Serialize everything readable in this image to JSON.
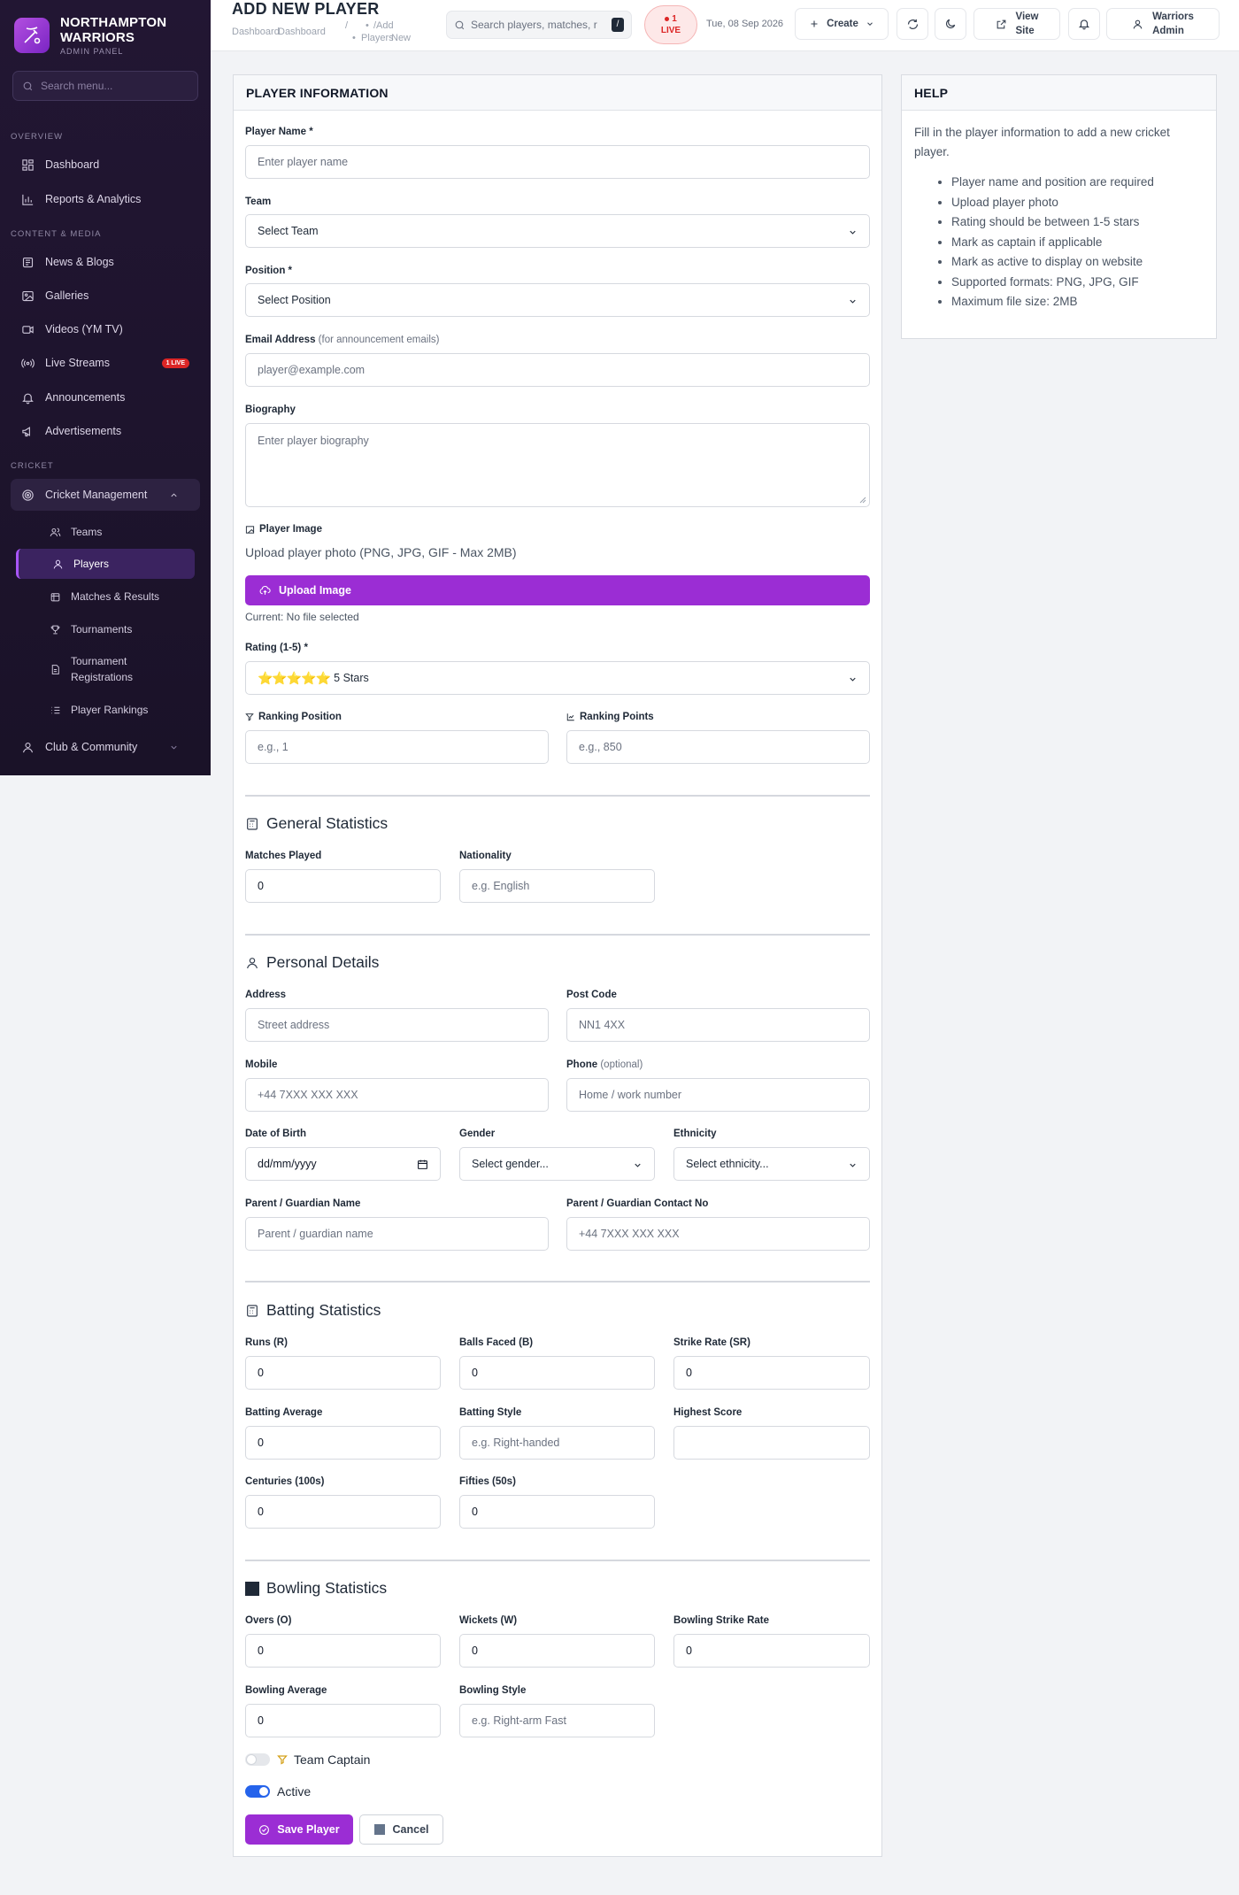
{
  "brand": {
    "name_line1": "NORTHAMPTON",
    "name_line2": "WARRIORS",
    "subtitle": "ADMIN PANEL"
  },
  "sidebar": {
    "search_placeholder": "Search menu...",
    "sections": {
      "overview": "OVERVIEW",
      "content": "CONTENT & MEDIA",
      "cricket": "CRICKET"
    },
    "items": {
      "dashboard": "Dashboard",
      "reports": "Reports & Analytics",
      "news": "News & Blogs",
      "galleries": "Galleries",
      "videos": "Videos (YM TV)",
      "live_streams": "Live Streams",
      "live_badge": "1 LIVE",
      "announcements": "Announcements",
      "advertisements": "Advertisements",
      "cricket_mgmt": "Cricket Management",
      "club": "Club & Community"
    },
    "sub_items": {
      "teams": "Teams",
      "players": "Players",
      "matches": "Matches & Results",
      "tournaments": "Tournaments",
      "registrations_1": "Tournament",
      "registrations_2": "Registrations",
      "rankings": "Player Rankings"
    }
  },
  "topbar": {
    "title": "ADD NEW PLAYER",
    "breadcrumbs": [
      "Dashboard",
      "Dashboard",
      "/",
      "/Add",
      "Players",
      "New"
    ],
    "search_placeholder": "Search players, matches, r",
    "search_kbd": "/",
    "live_count": "1",
    "live_label": "LIVE",
    "date": "Tue, 08 Sep 2026",
    "create_label": "Create",
    "view_site_1": "View",
    "view_site_2": "Site",
    "user_1": "Warriors",
    "user_2": "Admin"
  },
  "form": {
    "header": "PLAYER INFORMATION",
    "player_name": {
      "label": "Player Name *",
      "placeholder": "Enter player name"
    },
    "team": {
      "label": "Team",
      "value": "Select Team"
    },
    "position": {
      "label": "Position *",
      "value": "Select Position"
    },
    "email": {
      "label": "Email Address",
      "hint": "(for announcement emails)",
      "placeholder": "player@example.com"
    },
    "biography": {
      "label": "Biography",
      "placeholder": "Enter player biography"
    },
    "image": {
      "label": "Player Image",
      "help": "Upload player photo (PNG, JPG, GIF - Max 2MB)",
      "button": "Upload Image",
      "current": "Current: No file selected"
    },
    "rating": {
      "label": "Rating (1-5) *",
      "stars": "⭐⭐⭐⭐⭐",
      "value": "5 Stars",
      "level": 5
    },
    "ranking_position": {
      "label": "Ranking Position",
      "placeholder": "e.g., 1"
    },
    "ranking_points": {
      "label": "Ranking Points",
      "placeholder": "e.g., 850"
    },
    "general": {
      "title": "General Statistics",
      "matches": {
        "label": "Matches Played",
        "value": "0"
      },
      "nationality": {
        "label": "Nationality",
        "placeholder": "e.g. English"
      }
    },
    "personal": {
      "title": "Personal Details",
      "address": {
        "label": "Address",
        "placeholder": "Street address"
      },
      "postcode": {
        "label": "Post Code",
        "placeholder": "NN1 4XX"
      },
      "mobile": {
        "label": "Mobile",
        "placeholder": "+44 7XXX XXX XXX"
      },
      "phone": {
        "label": "Phone",
        "hint": "(optional)",
        "placeholder": "Home / work number"
      },
      "dob": {
        "label": "Date of Birth",
        "placeholder": "dd/mm/yyyy"
      },
      "gender": {
        "label": "Gender",
        "value": "Select gender..."
      },
      "ethnicity": {
        "label": "Ethnicity",
        "value": "Select ethnicity..."
      },
      "guardian_name": {
        "label": "Parent / Guardian Name",
        "placeholder": "Parent / guardian name"
      },
      "guardian_contact": {
        "label": "Parent / Guardian Contact No",
        "placeholder": "+44 7XXX XXX XXX"
      }
    },
    "batting": {
      "title": "Batting Statistics",
      "runs": {
        "label": "Runs (R)",
        "value": "0"
      },
      "balls": {
        "label": "Balls Faced (B)",
        "value": "0"
      },
      "strike_rate": {
        "label": "Strike Rate (SR)",
        "value": "0"
      },
      "average": {
        "label": "Batting Average",
        "value": "0"
      },
      "style": {
        "label": "Batting Style",
        "placeholder": "e.g. Right-handed"
      },
      "highest": {
        "label": "Highest Score",
        "value": ""
      },
      "centuries": {
        "label": "Centuries (100s)",
        "value": "0"
      },
      "fifties": {
        "label": "Fifties (50s)",
        "value": "0"
      }
    },
    "bowling": {
      "title": "Bowling Statistics",
      "overs": {
        "label": "Overs (O)",
        "value": "0"
      },
      "wickets": {
        "label": "Wickets (W)",
        "value": "0"
      },
      "strike_rate": {
        "label": "Bowling Strike Rate",
        "value": "0"
      },
      "average": {
        "label": "Bowling Average",
        "value": "0"
      },
      "style": {
        "label": "Bowling Style",
        "placeholder": "e.g. Right-arm Fast"
      }
    },
    "captain": {
      "label": "Team Captain",
      "on": false
    },
    "active": {
      "label": "Active",
      "on": true
    },
    "save": "Save Player",
    "cancel": "Cancel"
  },
  "help": {
    "title": "HELP",
    "intro": "Fill in the player information to add a new cricket player.",
    "items": [
      "Player name and position are required",
      "Upload player photo",
      "Rating should be between 1-5 stars",
      "Mark as captain if applicable",
      "Mark as active to display on website",
      "Supported formats: PNG, JPG, GIF",
      "Maximum file size: 2MB"
    ]
  },
  "colors": {
    "accent": "#9b2dd4",
    "sidebar_bg": "#221633",
    "live_red": "#dc2626",
    "toggle_blue": "#2563eb"
  }
}
